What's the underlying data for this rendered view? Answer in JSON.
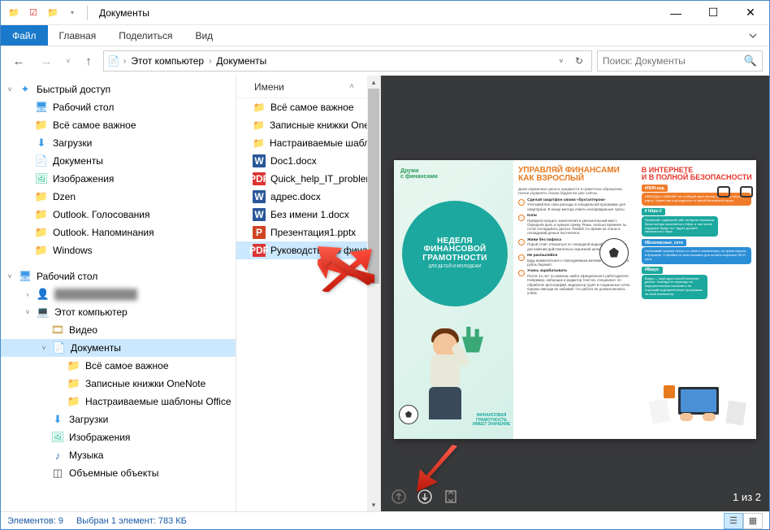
{
  "window": {
    "title": "Документы"
  },
  "ribbon": {
    "file": "Файл",
    "tabs": [
      "Главная",
      "Поделиться",
      "Вид"
    ]
  },
  "address": {
    "crumbs": [
      "Этот компьютер",
      "Документы"
    ]
  },
  "search": {
    "placeholder": "Поиск: Документы"
  },
  "nav": {
    "quick_access": "Быстрый доступ",
    "quick_items": [
      {
        "label": "Рабочий стол",
        "icon": "desktop"
      },
      {
        "label": "Всё самое важное",
        "icon": "folder"
      },
      {
        "label": "Загрузки",
        "icon": "down"
      },
      {
        "label": "Документы",
        "icon": "doc"
      },
      {
        "label": "Изображения",
        "icon": "img"
      },
      {
        "label": "Dzen",
        "icon": "folder"
      },
      {
        "label": "Outlook. Голосования",
        "icon": "folder"
      },
      {
        "label": "Outlook. Напоминания",
        "icon": "folder"
      },
      {
        "label": "Windows",
        "icon": "folder"
      }
    ],
    "desktop": "Рабочий стол",
    "user_blur": "                      ",
    "this_pc": "Этот компьютер",
    "pc_items": [
      {
        "label": "Видео",
        "icon": "video"
      },
      {
        "label": "Документы",
        "icon": "doc",
        "selected": true,
        "expanded": true
      },
      {
        "label": "Всё самое важное",
        "icon": "folder",
        "sub": true
      },
      {
        "label": "Записные книжки OneNote",
        "icon": "folder",
        "sub": true
      },
      {
        "label": "Настраиваемые шаблоны Office",
        "icon": "folder",
        "sub": true
      },
      {
        "label": "Загрузки",
        "icon": "down"
      },
      {
        "label": "Изображения",
        "icon": "img"
      },
      {
        "label": "Музыка",
        "icon": "music"
      },
      {
        "label": "Объемные объекты",
        "icon": "3d"
      }
    ]
  },
  "filelist": {
    "column": "Имени",
    "rows": [
      {
        "name": "Всё самое важное",
        "icon": "folder"
      },
      {
        "name": "Записные книжки OneNote",
        "icon": "folder"
      },
      {
        "name": "Настраиваемые шаблоны",
        "icon": "folder"
      },
      {
        "name": "Doc1.docx",
        "icon": "word"
      },
      {
        "name": "Quick_help_IT_problems.pdf",
        "icon": "pdf"
      },
      {
        "name": "адрес.docx",
        "icon": "word"
      },
      {
        "name": "Без имени 1.docx",
        "icon": "word"
      },
      {
        "name": "Презентация1.pptx",
        "icon": "ppt"
      },
      {
        "name": "Руководство по финансовой",
        "icon": "pdf",
        "selected": true
      }
    ]
  },
  "preview": {
    "page_indicator": "1 из 2",
    "pdf": {
      "logo": "Дружи\nс финансами",
      "circle_big": "НЕДЕЛЯ\nФИНАНСОВОЙ\nГРАМОТНОСТИ",
      "circle_small": "ДЛЯ ДЕТЕЙ И МОЛОДЕЖИ",
      "tagline": "ФИНАНСОВАЯ\nГРАМОТНОСТЬ\nИМЕЕТ ЗНАЧЕНИЕ",
      "mid_title": "УПРАВЛЯЙ ФИНАНСАМИ\nКАК ВЗРОСЛЫЙ",
      "mid_intro": "Даже карманные деньги нуждаются в грамотном обращении. Начни управлять своим бюджетом уже сейчас.",
      "mid_items": [
        {
          "h": "Сделай смартфон своим «бухгалтером»",
          "t": "Учитывай все свои расходы в специальной программе для смартфона. В конце месяца отметь неоправданные траты."
        },
        {
          "h": "Копи",
          "t": "Преврати процесс накопления в увлекательный квест. Определи цель и нужную сумму. Реши, сколько времени ты готов откладывать деньги. Разбей это время на этапы и откладывай деньги постепенно."
        },
        {
          "h": "Живи без пафоса",
          "t": "Порой стоит отказаться от очередной модной новинки ради достижения действительно серьёзной цели."
        },
        {
          "h": "Не распыляйся",
          "t": "Будь внимательнее к повседневным мелким тратам: копейка рубль бережёт."
        },
        {
          "h": "Учись зарабатывать",
          "t": "После 14 лет ты можешь найти официального работодателя. Например, наборщик и редактор текстов, специалист по обработке фотографий, модератор групп в социальных сетях. Однако никогда не забывай, что работа не должна мешать учёбе."
        }
      ],
      "right_title": "В ИНТЕРНЕТЕ\nИ В ПОЛНОЙ БЕЗОПАСНОСТИ",
      "right_sections": [
        {
          "tag": "#ПИН-код",
          "color": "orange",
          "t": "НИКОГДА и НИКОМУ не сообщай свои личные данные и пин-код карты. Храни пин-код отдельно от своей банковской карты."
        },
        {
          "tag": "# https://",
          "color": "teal",
          "t": "Проверяй: надёжный сайт интернет-магазина, банка всегда начинается с https, в том числе содержит букву «s». Адрес должен начинаться с https."
        },
        {
          "tag": "#Безопасные_сети",
          "color": "blue",
          "t": "Оплачивай покупки только со своего компьютера, не храни пароли в браузере. Старайся не использовать для оплаты открытые Wi-Fi сети."
        },
        {
          "tag": "#Вирус",
          "color": "teal",
          "t": "Вирус — ещё один способ похитить деньги. Никогда не переходи по подозрительным ссылкам и не открывай подозрительные программы на свой компьютер."
        }
      ]
    }
  },
  "status": {
    "items_label": "Элементов:",
    "items_count": "9",
    "selected_label": "Выбран 1 элемент:",
    "selected_size": "783 КБ"
  }
}
